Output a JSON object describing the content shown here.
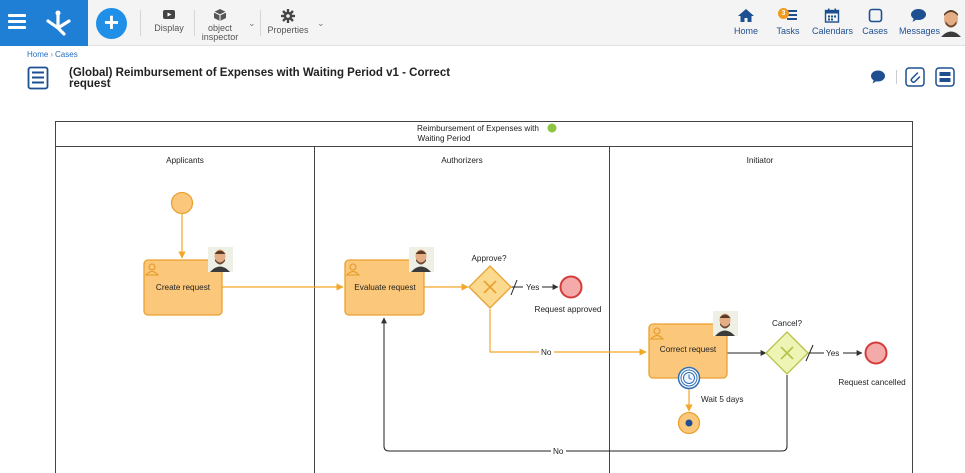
{
  "topbar": {
    "display_label": "Display",
    "object_inspector_label_line1": "object",
    "object_inspector_label_line2": "inspector",
    "properties_label": "Properties",
    "nav": {
      "home": "Home",
      "tasks": "Tasks",
      "tasks_badge": "3",
      "calendars": "Calendars",
      "cases": "Cases",
      "messages": "Messages"
    }
  },
  "breadcrumb": {
    "home": "Home",
    "separator": "›",
    "cases": "Cases"
  },
  "page": {
    "title_line1": "(Global) Reimbursement of Expenses with Waiting Period v1 - Correct",
    "title_line2": "request"
  },
  "diagram": {
    "pool_title_line1": "Reimbursement of Expenses with",
    "pool_title_line2": "Waiting Period",
    "lanes": [
      "Applicants",
      "Authorizers",
      "Initiator"
    ],
    "tasks": {
      "create": "Create request",
      "evaluate": "Evaluate request",
      "correct": "Correct request"
    },
    "gateways": {
      "approve": "Approve?",
      "cancel": "Cancel?"
    },
    "events": {
      "approved": "Request approved",
      "cancelled": "Request cancelled",
      "timer": "Wait 5 days"
    },
    "flows": {
      "yes1": "Yes",
      "no1": "No",
      "yes2": "Yes",
      "no2": "No"
    },
    "colors": {
      "task_fill": "#fbc77a",
      "task_stroke": "#e9a130",
      "flow": "#f3a72a",
      "gateway_fill": "#fbd98f",
      "cancel_gateway_fill": "#eef5b4",
      "end_fill": "#f5aaaa",
      "end_stroke": "#d43c3c",
      "status_dot": "#8cc63e"
    }
  }
}
